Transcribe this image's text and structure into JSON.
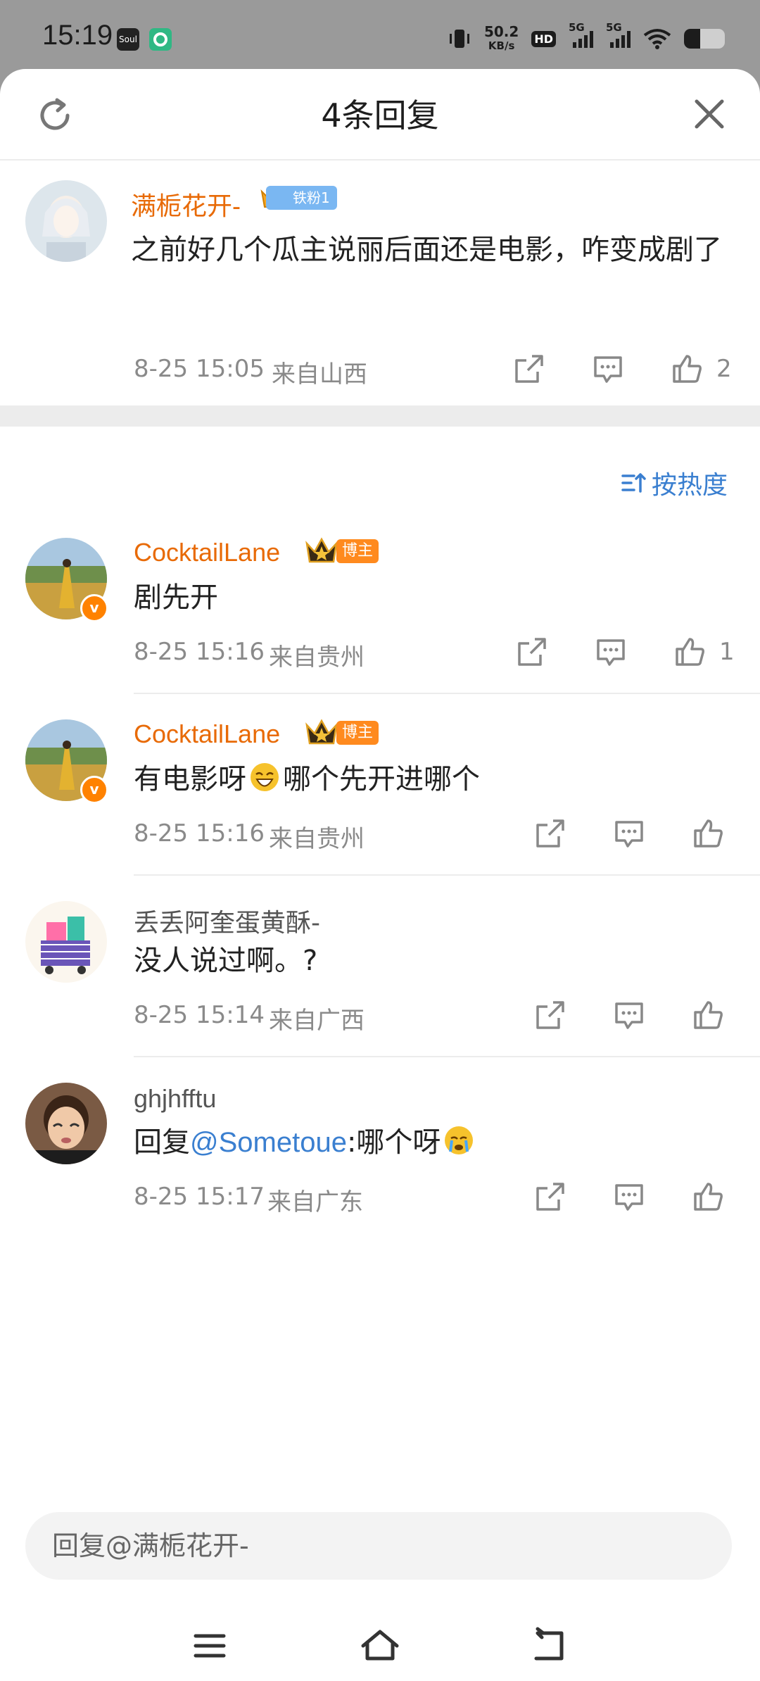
{
  "status_bar": {
    "time": "15:19",
    "net_speed_value": "50.2",
    "net_speed_unit": "KB/s",
    "hd_label": "HD",
    "sim1_label": "5G",
    "sim2_label": "5G",
    "app_icon_1": "Soul",
    "battery_level": 0.4
  },
  "header": {
    "title": "4条回复",
    "refresh_icon": "refresh-icon",
    "close_icon": "close-icon"
  },
  "main_comment": {
    "username": "满栀花开-",
    "fan_badge": "铁粉1",
    "text": "之前好几个瓜主说丽后面还是电影，咋变成剧了",
    "time": "8-25 15:05",
    "location": "来自山西",
    "like_count": "2"
  },
  "sort": {
    "label": "按热度"
  },
  "replies": [
    {
      "username": "CocktailLane",
      "badge": "博主",
      "text": "剧先开",
      "time": "8-25 15:16",
      "location": "来自贵州",
      "like_count": "1"
    },
    {
      "username": "CocktailLane",
      "badge": "博主",
      "text_before": "有电影呀",
      "text_after": "哪个先开进哪个",
      "time": "8-25 15:16",
      "location": "来自贵州",
      "like_count": ""
    },
    {
      "username": "丢丢阿奎蛋黄酥-",
      "text": "没人说过啊。?",
      "time": "8-25 15:14",
      "location": "来自广西",
      "like_count": ""
    },
    {
      "username": "ghjhfftu",
      "reply_prefix": "回复",
      "mention": "@Sometoue",
      "text_after": ":哪个呀",
      "time": "8-25 15:17",
      "location": "来自广东",
      "like_count": ""
    }
  ],
  "input": {
    "placeholder": "回复@满栀花开-"
  },
  "colors": {
    "accent_orange": "#e86a06",
    "link_blue": "#3a7fd0",
    "muted_gray": "#8a8a8a"
  }
}
